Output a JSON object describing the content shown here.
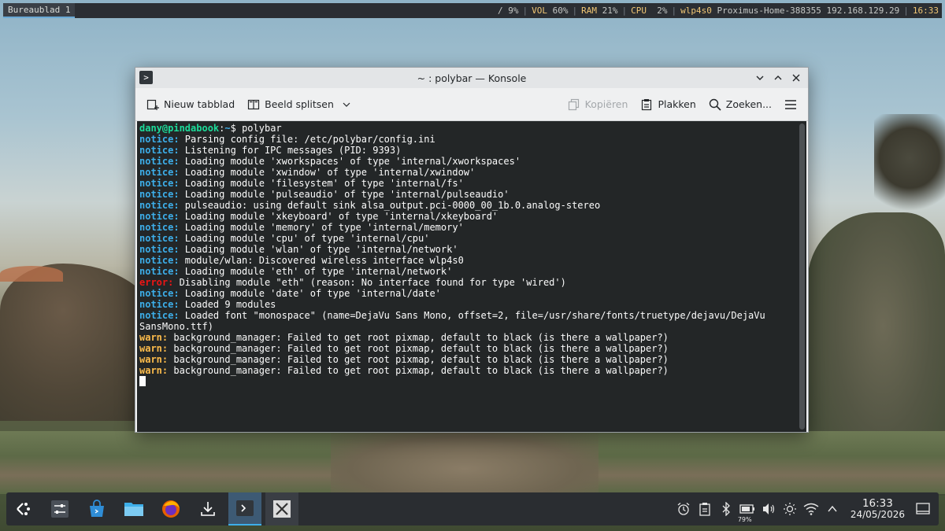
{
  "topbar": {
    "workspace": "Bureaublad 1",
    "fs": "/ 9%",
    "vol_label": "VOL",
    "vol_value": "60%",
    "ram_label": "RAM",
    "ram_value": "21%",
    "cpu_label": "CPU",
    "cpu_value": " 2%",
    "wlan_label": "wlp4s0",
    "wlan_value": "Proximus-Home-388355 192.168.129.29",
    "time": "16:33"
  },
  "window": {
    "title": "~ : polybar — Konsole",
    "toolbar": {
      "new_tab": "Nieuw tabblad",
      "split": "Beeld splitsen",
      "copy": "Kopiëren",
      "paste": "Plakken",
      "find": "Zoeken..."
    }
  },
  "terminal": {
    "prompt_user": "dany@pindabook",
    "prompt_sep": ":",
    "prompt_path": "~",
    "prompt_cmd": "$ polybar",
    "lines": [
      {
        "tag": "notice:",
        "text": " Parsing config file: /etc/polybar/config.ini"
      },
      {
        "tag": "notice:",
        "text": " Listening for IPC messages (PID: 9393)"
      },
      {
        "tag": "notice:",
        "text": " Loading module 'xworkspaces' of type 'internal/xworkspaces'"
      },
      {
        "tag": "notice:",
        "text": " Loading module 'xwindow' of type 'internal/xwindow'"
      },
      {
        "tag": "notice:",
        "text": " Loading module 'filesystem' of type 'internal/fs'"
      },
      {
        "tag": "notice:",
        "text": " Loading module 'pulseaudio' of type 'internal/pulseaudio'"
      },
      {
        "tag": "notice:",
        "text": " pulseaudio: using default sink alsa_output.pci-0000_00_1b.0.analog-stereo"
      },
      {
        "tag": "notice:",
        "text": " Loading module 'xkeyboard' of type 'internal/xkeyboard'"
      },
      {
        "tag": "notice:",
        "text": " Loading module 'memory' of type 'internal/memory'"
      },
      {
        "tag": "notice:",
        "text": " Loading module 'cpu' of type 'internal/cpu'"
      },
      {
        "tag": "notice:",
        "text": " Loading module 'wlan' of type 'internal/network'"
      },
      {
        "tag": "notice:",
        "text": " module/wlan: Discovered wireless interface wlp4s0"
      },
      {
        "tag": "notice:",
        "text": " Loading module 'eth' of type 'internal/network'"
      },
      {
        "tag": "error:",
        "text": " Disabling module \"eth\" (reason: No interface found for type 'wired')"
      },
      {
        "tag": "notice:",
        "text": " Loading module 'date' of type 'internal/date'"
      },
      {
        "tag": "notice:",
        "text": " Loaded 9 modules"
      },
      {
        "tag": "notice:",
        "text": " Loaded font \"monospace\" (name=DejaVu Sans Mono, offset=2, file=/usr/share/fonts/truetype/dejavu/DejaVu"
      },
      {
        "tag": "",
        "text": "SansMono.ttf)"
      },
      {
        "tag": "warn:",
        "text": " background_manager: Failed to get root pixmap, default to black (is there a wallpaper?)"
      },
      {
        "tag": "warn:",
        "text": " background_manager: Failed to get root pixmap, default to black (is there a wallpaper?)"
      },
      {
        "tag": "warn:",
        "text": " background_manager: Failed to get root pixmap, default to black (is there a wallpaper?)"
      },
      {
        "tag": "warn:",
        "text": " background_manager: Failed to get root pixmap, default to black (is there a wallpaper?)"
      }
    ]
  },
  "taskbar": {
    "battery": "79%",
    "time": "16:33",
    "date": "24/05/2026",
    "apps": [
      "app-launcher",
      "system-settings",
      "discover",
      "dolphin",
      "firefox",
      "downloads",
      "konsole",
      "xserver"
    ]
  },
  "colors": {
    "notice": "#3daee9",
    "error": "#ed1515",
    "warn": "#fdbc4b",
    "prompt_user": "#1cdc9a",
    "terminal_bg": "#232627"
  }
}
